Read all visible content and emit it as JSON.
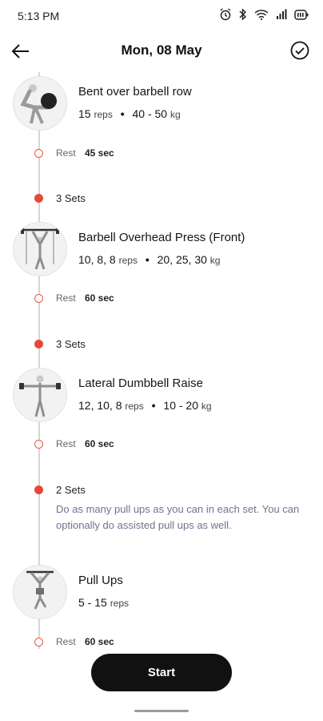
{
  "status_bar": {
    "time": "5:13 PM"
  },
  "header": {
    "title": "Mon, 08 May"
  },
  "exercises": [
    {
      "name": "Bent over barbell row",
      "reps": "15",
      "reps_unit": "reps",
      "weight": "40 - 50",
      "weight_unit": "kg",
      "rest_label": "Rest",
      "rest_value": "45 sec"
    },
    {
      "sets": "3 Sets",
      "name": "Barbell Overhead Press (Front)",
      "reps": "10, 8, 8",
      "reps_unit": "reps",
      "weight": "20, 25, 30",
      "weight_unit": "kg",
      "rest_label": "Rest",
      "rest_value": "60 sec"
    },
    {
      "sets": "3 Sets",
      "name": "Lateral Dumbbell Raise",
      "reps": "12, 10, 8",
      "reps_unit": "reps",
      "weight": "10 - 20",
      "weight_unit": "kg",
      "rest_label": "Rest",
      "rest_value": "60 sec"
    },
    {
      "sets": "2 Sets",
      "note": "Do as many pull ups as you can in each set. You can optionally do assisted pull ups as well.",
      "name": "Pull Ups",
      "reps": "5 - 15",
      "reps_unit": "reps",
      "rest_label": "Rest",
      "rest_value": "60 sec"
    }
  ],
  "footer": {
    "start_label": "Start"
  },
  "colors": {
    "accent": "#e9473a",
    "note_text": "#6d7390",
    "button": "#111111"
  },
  "icons": [
    "alarm-icon",
    "bluetooth-icon",
    "wifi-icon",
    "signal-icon",
    "battery-icon",
    "back-arrow-icon",
    "check-circle-icon"
  ]
}
